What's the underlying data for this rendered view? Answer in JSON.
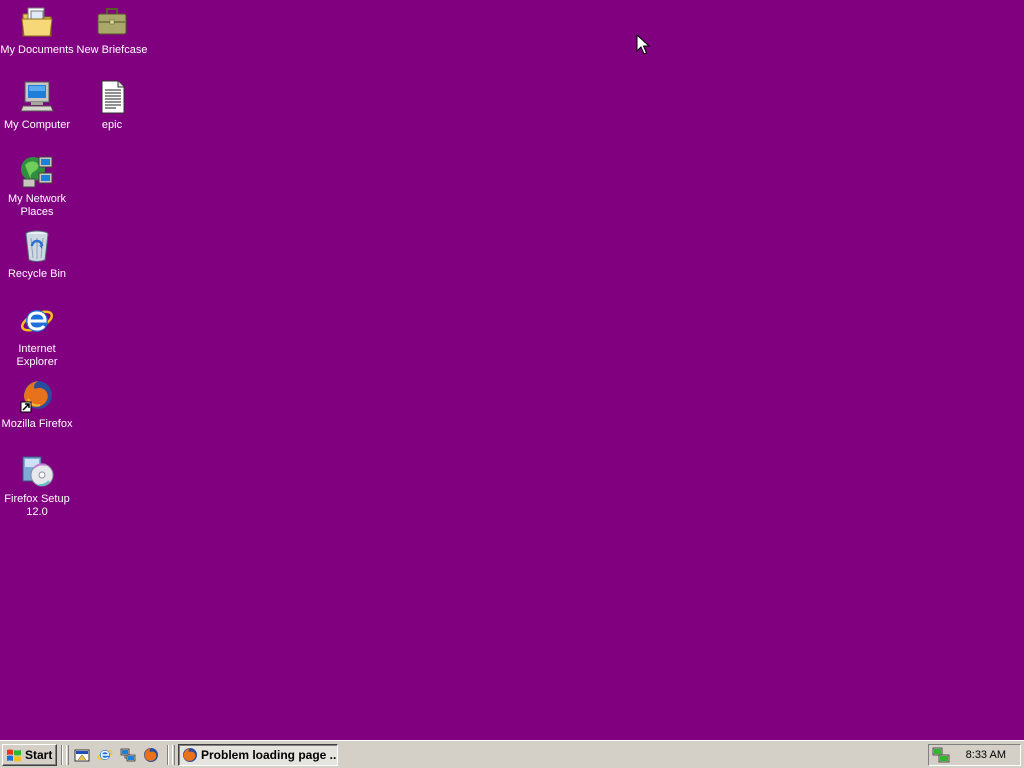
{
  "desktop": {
    "background_color": "#800080",
    "icons": [
      {
        "label": "My Documents",
        "icon": "my-documents-icon"
      },
      {
        "label": "New Briefcase",
        "icon": "briefcase-icon"
      },
      {
        "label": "My Computer",
        "icon": "my-computer-icon"
      },
      {
        "label": "epic",
        "icon": "text-document-icon"
      },
      {
        "label": "My Network Places",
        "icon": "network-places-icon"
      },
      {
        "label": "Recycle Bin",
        "icon": "recycle-bin-icon"
      },
      {
        "label": "Internet Explorer",
        "icon": "internet-explorer-icon"
      },
      {
        "label": "Mozilla Firefox",
        "icon": "firefox-shortcut-icon"
      },
      {
        "label": "Firefox Setup 12.0",
        "icon": "installer-icon"
      }
    ]
  },
  "taskbar": {
    "start_label": "Start",
    "quick_launch": [
      {
        "icon": "show-desktop-icon"
      },
      {
        "icon": "internet-explorer-icon"
      },
      {
        "icon": "network-icon"
      },
      {
        "icon": "firefox-icon"
      }
    ],
    "tasks": [
      {
        "label": "Problem loading page ...",
        "icon": "firefox-icon",
        "active": true
      }
    ],
    "tray": {
      "icons": [
        "network-connection-icon"
      ],
      "clock": "8:33 AM"
    }
  }
}
